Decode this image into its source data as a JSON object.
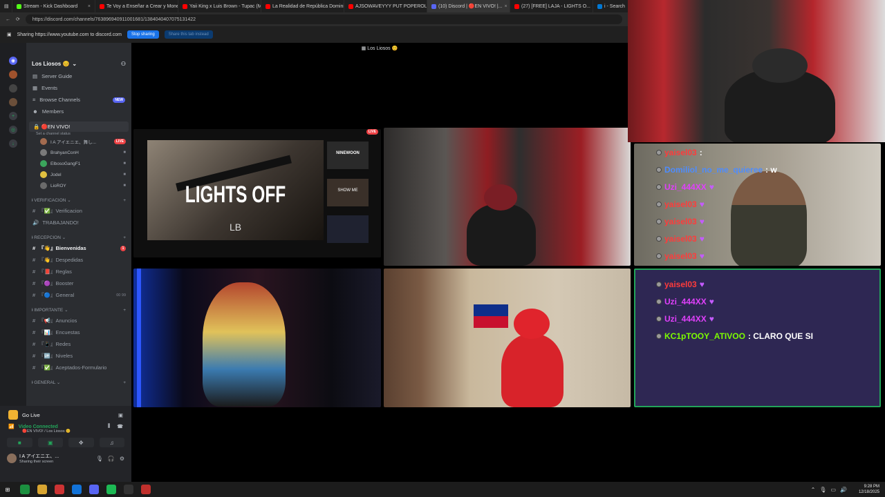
{
  "browser": {
    "tabs": [
      {
        "title": "Stream - Kick Dashboard",
        "color": "#53fc18"
      },
      {
        "title": "Te Voy a Enseñar a Crear y Monet...",
        "color": "#ff0000"
      },
      {
        "title": "Yaii King x Luis Brown - Tupac (M...",
        "color": "#ff0000"
      },
      {
        "title": "La Realidad de República Domini...",
        "color": "#ff0000"
      },
      {
        "title": "AJSOWAVEYYY PUT POPEROLIN...",
        "color": "#ff0000"
      },
      {
        "title": "(10) Discord | 🔴EN VIVO! |...",
        "color": "#5865f2"
      },
      {
        "title": "(27) [FREE] LAJA - LIGHTS O...",
        "color": "#ff0000"
      },
      {
        "title": "i - Search",
        "color": "#0078d4"
      }
    ],
    "url": "https://discord.com/channels/763896940911001681/1384040407075131422",
    "share_text": "Sharing https://www.youtube.com to discord.com",
    "stop_sharing": "Stop sharing",
    "share_this_tab": "Share this tab instead"
  },
  "server": {
    "name": "Los Liosos 😊",
    "nav": [
      {
        "label": "Server Guide",
        "icon": "book"
      },
      {
        "label": "Events",
        "icon": "calendar"
      },
      {
        "label": "Browse Channels",
        "icon": "compass",
        "badge": "NEW"
      },
      {
        "label": "Members",
        "icon": "people"
      }
    ],
    "voice_channel": {
      "name": "🔴EN VIVO!",
      "status": "Set a channel status",
      "users": [
        {
          "name": "I A アイエニエ、舞し...",
          "live": "LIVE",
          "color": "#a36b4f"
        },
        {
          "name": "BrahyanConH",
          "color": "#7a7a7a"
        },
        {
          "name": "ElbosoGangF1",
          "color": "#3ba55c"
        },
        {
          "name": "Jodel",
          "color": "#e0c040"
        },
        {
          "name": "LioROY",
          "color": "#6b6b6b"
        }
      ]
    },
    "categories": [
      {
        "name": "VERIFICACION",
        "channels": [
          {
            "label": "『✅』Verificacion",
            "bold": false
          },
          {
            "label": "TRABAJANDO!",
            "bold": false,
            "voice": true
          }
        ]
      },
      {
        "name": "RECEPCION",
        "channels": [
          {
            "label": "『👋』Bienvenidas",
            "bold": true,
            "badge": "1"
          },
          {
            "label": "『👋』Despedidas",
            "bold": false
          },
          {
            "label": "『📕』Reglas",
            "bold": false
          },
          {
            "label": "『🟣』Booster",
            "bold": false
          },
          {
            "label": "『🔵』General",
            "bold": false,
            "count": "00 99"
          }
        ]
      },
      {
        "name": "IMPORTANTE",
        "channels": [
          {
            "label": "『📢』Anuncios",
            "bold": false
          },
          {
            "label": "『📊』Encuestas",
            "bold": false
          },
          {
            "label": "『📱』Redes",
            "bold": false
          },
          {
            "label": "『🆙』Niveles",
            "bold": false
          },
          {
            "label": "『✅』Aceptados-Formulario",
            "bold": false
          }
        ]
      },
      {
        "name": "GENERAL",
        "channels": []
      }
    ]
  },
  "bottom": {
    "go_live": "Go Live",
    "video_connected": "Video Connected",
    "video_channel": "🔴EN VIVO! / Los Liosos 😊",
    "user_name": "I A アイエニエ、...",
    "user_status": "Sharing their screen"
  },
  "stage": {
    "title": "Los Liosos 😊",
    "youtube_overlay": "LIGHTS OFF",
    "youtube_logo": "LB",
    "youtube_thumb_1": "NINEWOON",
    "youtube_thumb_2": "SHOW ME",
    "live_badge": "LIVE"
  },
  "chat": {
    "top_lines": [
      {
        "user": "yaisel03",
        "text": ":",
        "color": "#ff3b3b"
      },
      {
        "user": "Domiliol_no_me_quieree",
        "text": ": w",
        "color": "#4d8cff"
      },
      {
        "user": "Uzi_444XX",
        "text": "",
        "color": "#e040fb"
      },
      {
        "user": "yaisel03",
        "text": "",
        "color": "#ff3b3b"
      },
      {
        "user": "yaisel03",
        "text": "",
        "color": "#ff3b3b"
      },
      {
        "user": "yaisel03",
        "text": "",
        "color": "#ff3b3b"
      },
      {
        "user": "yaisel03",
        "text": "",
        "color": "#ff3b3b"
      }
    ],
    "bottom_lines": [
      {
        "user": "yaisel03",
        "text": "",
        "color": "#ff3b3b"
      },
      {
        "user": "Uzi_444XX",
        "text": "",
        "color": "#e040fb"
      },
      {
        "user": "Uzi_444XX",
        "text": "",
        "color": "#e040fb"
      },
      {
        "user": "KC1pTOOY_ATIVOO",
        "text": ": CLARO QUE SI",
        "color": "#7cfc00"
      }
    ]
  },
  "taskbar": {
    "time": "9:28 PM",
    "date": "12/18/2025"
  }
}
